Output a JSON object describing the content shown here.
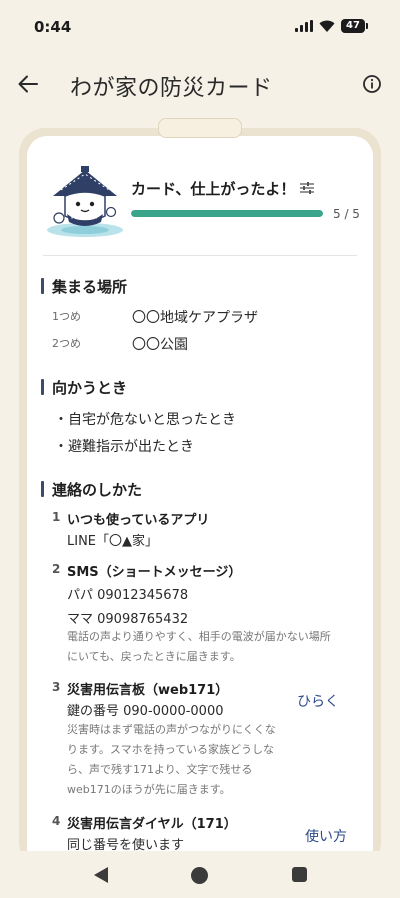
{
  "status": {
    "time": "0:44",
    "battery": "47"
  },
  "header": {
    "title": "わが家の防災カード"
  },
  "hero": {
    "title": "カード、仕上がったよ！",
    "progress_text": "5 / 5",
    "progress_fraction": 1.0
  },
  "sections": {
    "gather": {
      "title": "集まる場所",
      "items": [
        {
          "label": "1つめ",
          "value": "〇〇地域ケアプラザ"
        },
        {
          "label": "2つめ",
          "value": "〇〇公園"
        }
      ]
    },
    "when": {
      "title": "向かうとき",
      "items": [
        "・自宅が危ないと思ったとき",
        "・避難指示が出たとき"
      ]
    },
    "contact": {
      "title": "連絡のしかた",
      "items": [
        {
          "num": "1",
          "title": "いつも使っているアプリ",
          "lines": [
            "LINE「〇▲家」"
          ]
        },
        {
          "num": "2",
          "title": "SMS（ショートメッセージ）",
          "lines": [
            "パパ 09012345678",
            "ママ 09098765432"
          ],
          "notes": [
            "電話の声より通りやすく、相手の電波が届かない場所",
            "にいても、戻ったときに届きます。"
          ]
        },
        {
          "num": "3",
          "title": "災害用伝言板（web171）",
          "lines": [
            "鍵の番号 090-0000-0000"
          ],
          "notes": [
            "災害時はまず電話の声がつながりにくくな",
            "ります。スマホを持っている家族どうしな",
            "ら、声で残す171より、文字で残せる",
            "web171のほうが先に届きます。"
          ],
          "action": "ひらく"
        },
        {
          "num": "4",
          "title": "災害用伝言ダイヤル（171）",
          "lines": [
            "同じ番号を使います"
          ],
          "action": "使い方"
        }
      ]
    }
  },
  "colors": {
    "accent_green": "#3aa58b",
    "link_blue": "#2e4a8a",
    "section_bar": "#3c4a6b",
    "background": "#f6f1e7"
  }
}
